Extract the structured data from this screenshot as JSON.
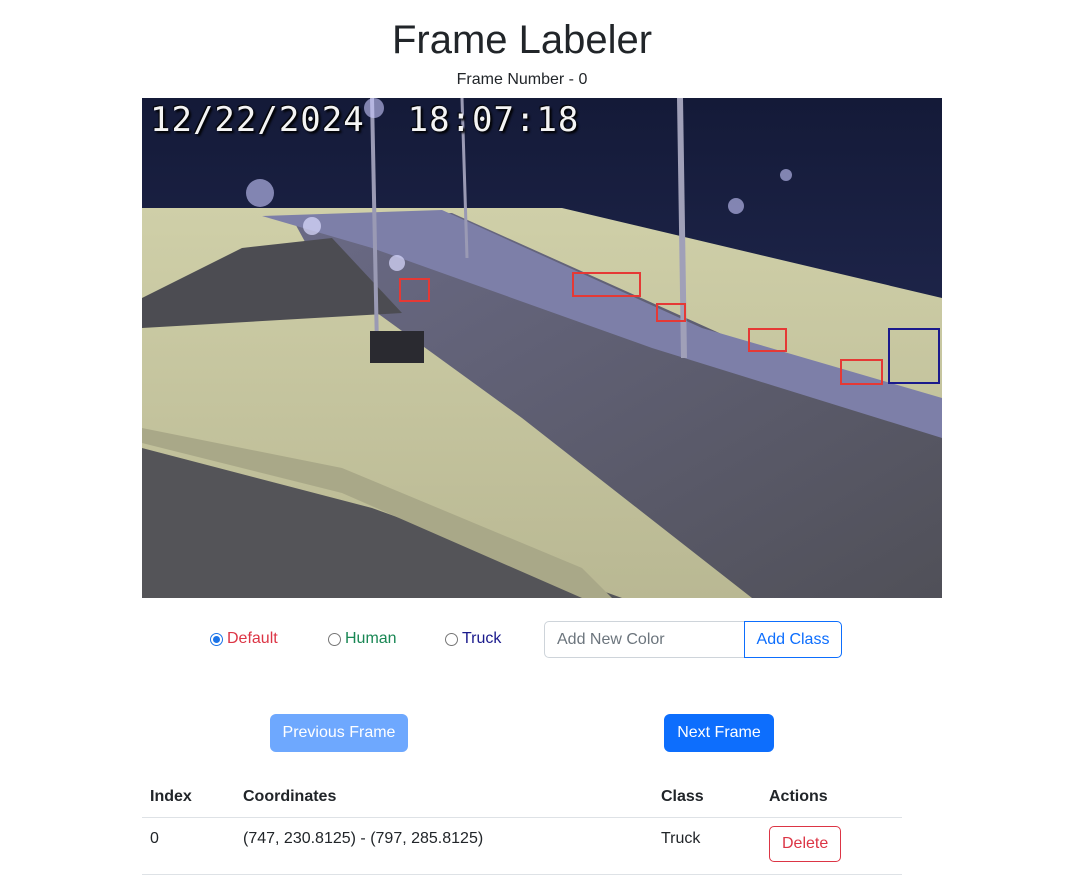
{
  "app": {
    "title": "Frame Labeler",
    "frame_number_label": "Frame Number - 0"
  },
  "frame": {
    "timestamp": "12/22/2024  18:07:18"
  },
  "classes": [
    {
      "label": "Default",
      "color": "#dc3545",
      "selected": true
    },
    {
      "label": "Human",
      "color": "#198754",
      "selected": false
    },
    {
      "label": "Truck",
      "color": "#1a1a8c",
      "selected": false
    }
  ],
  "new_color": {
    "placeholder": "Add New Color",
    "button": "Add Class"
  },
  "navigation": {
    "prev": "Previous Frame",
    "next": "Next Frame"
  },
  "table": {
    "headers": {
      "index": "Index",
      "coordinates": "Coordinates",
      "class": "Class",
      "actions": "Actions"
    },
    "rows": [
      {
        "index": "0",
        "coordinates": "(747, 230.8125) - (797, 285.8125)",
        "class": "Truck",
        "action": "Delete"
      }
    ]
  }
}
